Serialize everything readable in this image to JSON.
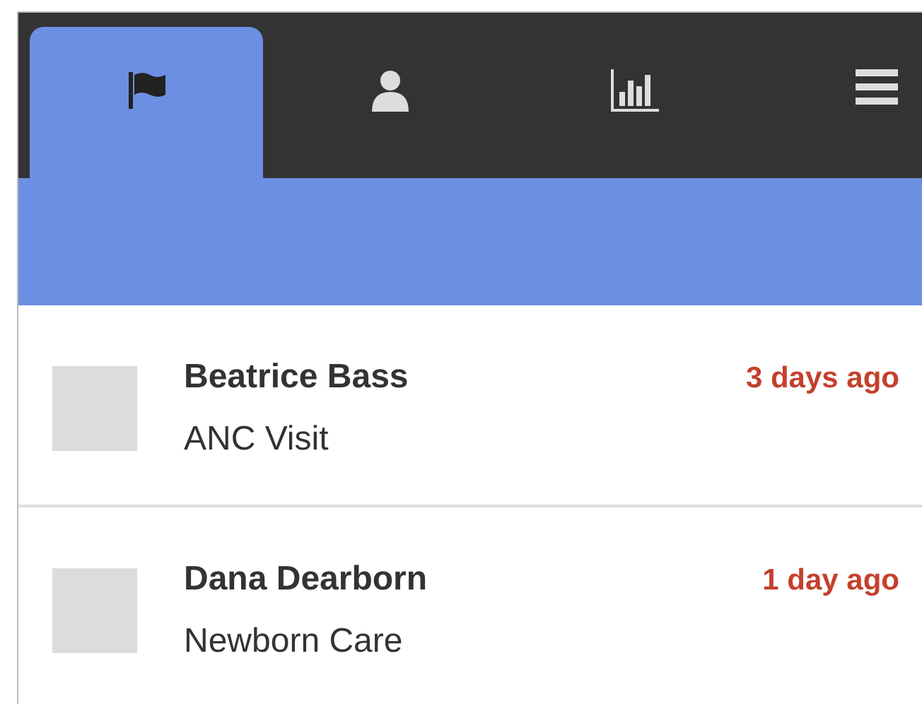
{
  "tabs": [
    {
      "kind": "flag",
      "selected": true
    },
    {
      "kind": "person",
      "selected": false
    },
    {
      "kind": "chart",
      "selected": false
    },
    {
      "kind": "menu",
      "selected": false
    }
  ],
  "tasks": [
    {
      "name": "Beatrice Bass",
      "type": "ANC Visit",
      "due": "3 days ago",
      "checked": false
    },
    {
      "name": "Dana Dearborn",
      "type": "Newborn Care",
      "due": "1 day ago",
      "checked": false
    }
  ]
}
